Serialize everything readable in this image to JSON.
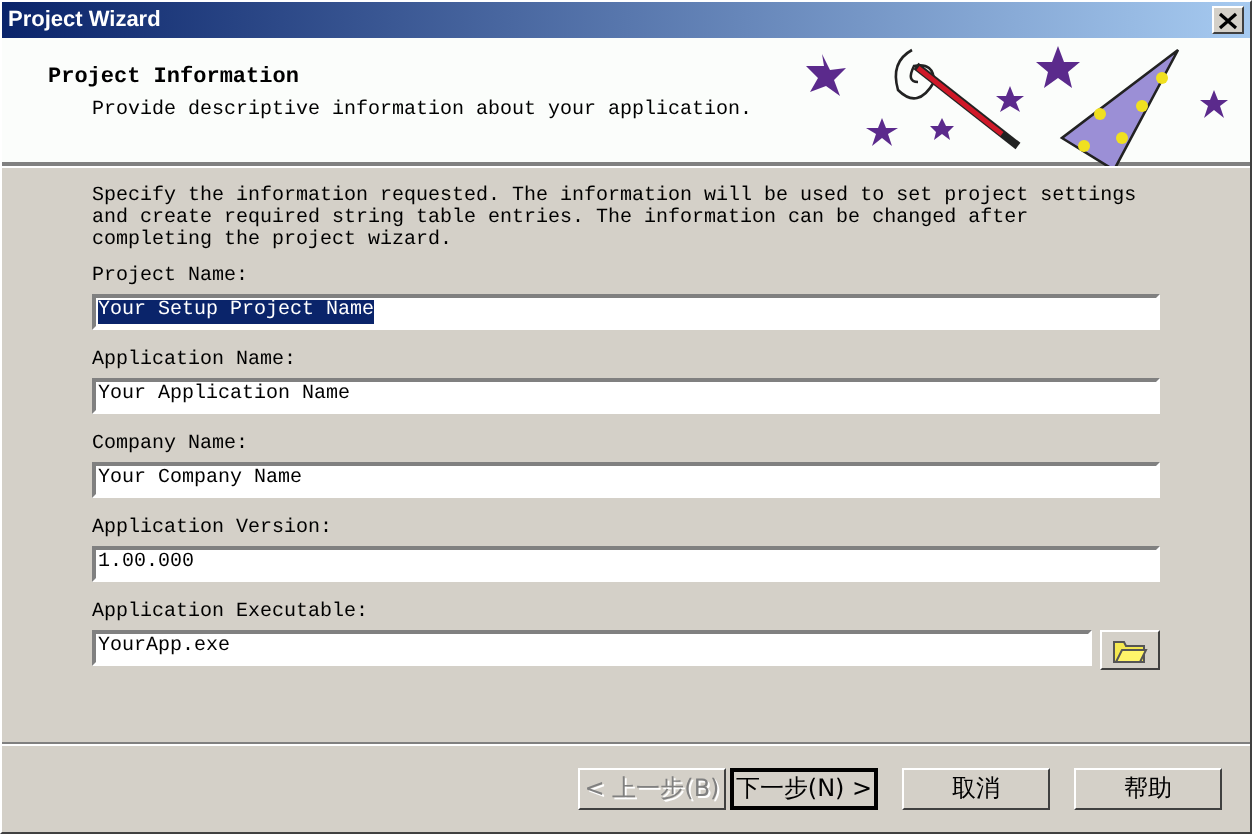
{
  "window": {
    "title": "Project Wizard"
  },
  "header": {
    "title": "Project Information",
    "subtitle": "Provide descriptive information about your application."
  },
  "intro": "Specify the information requested.  The information will be used to set project settings and create required string table entries.  The information can be changed after completing the project wizard.",
  "fields": [
    {
      "label": "Project Name:",
      "value": "Your Setup Project Name",
      "text_selected": true,
      "browse": false
    },
    {
      "label": "Application Name:",
      "value": "Your Application Name",
      "text_selected": false,
      "browse": false
    },
    {
      "label": "Company Name:",
      "value": "Your Company Name",
      "text_selected": false,
      "browse": false
    },
    {
      "label": "Application Version:",
      "value": "1.00.000",
      "text_selected": false,
      "browse": false
    },
    {
      "label": "Application Executable:",
      "value": "YourApp.exe",
      "text_selected": false,
      "browse": true
    }
  ],
  "buttons": [
    {
      "label": "< 上一步(B)",
      "disabled": true,
      "default": false
    },
    {
      "label": "下一步(N) >",
      "disabled": false,
      "default": true
    },
    {
      "label": "取消",
      "disabled": false,
      "default": false
    },
    {
      "label": "帮助",
      "disabled": false,
      "default": false
    }
  ]
}
